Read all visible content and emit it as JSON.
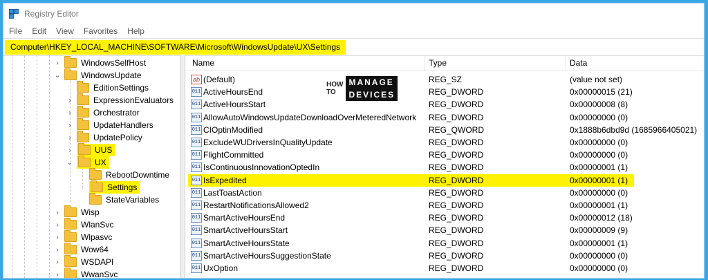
{
  "window": {
    "title": "Registry Editor"
  },
  "menu": [
    "File",
    "Edit",
    "View",
    "Favorites",
    "Help"
  ],
  "address": "Computer\\HKEY_LOCAL_MACHINE\\SOFTWARE\\Microsoft\\WindowsUpdate\\UX\\Settings",
  "tree": [
    {
      "label": "WindowsSelfHost",
      "expander": "›"
    },
    {
      "label": "WindowsUpdate",
      "expander": "⌄"
    },
    {
      "label": "EditionSettings",
      "expander": ""
    },
    {
      "label": "ExpressionEvaluators",
      "expander": "›"
    },
    {
      "label": "Orchestrator",
      "expander": "›"
    },
    {
      "label": "UpdateHandlers",
      "expander": "›"
    },
    {
      "label": "UpdatePolicy",
      "expander": "›"
    },
    {
      "label": "UUS",
      "expander": "›"
    },
    {
      "label": "UX",
      "expander": "⌄"
    },
    {
      "label": "RebootDowntime",
      "expander": ""
    },
    {
      "label": "Settings",
      "expander": ""
    },
    {
      "label": "StateVariables",
      "expander": ""
    },
    {
      "label": "Wisp",
      "expander": "›"
    },
    {
      "label": "WlanSvc",
      "expander": "›"
    },
    {
      "label": "Wlpasvc",
      "expander": "›"
    },
    {
      "label": "Wow64",
      "expander": "›"
    },
    {
      "label": "WSDAPI",
      "expander": "›"
    },
    {
      "label": "WwanSvc",
      "expander": "›"
    }
  ],
  "columns": {
    "name": "Name",
    "type": "Type",
    "data": "Data"
  },
  "values": [
    {
      "name": "(Default)",
      "type": "REG_SZ",
      "data": "(value not set)",
      "icon": "ab"
    },
    {
      "name": "ActiveHoursEnd",
      "type": "REG_DWORD",
      "data": "0x00000015 (21)",
      "icon": "011"
    },
    {
      "name": "ActiveHoursStart",
      "type": "REG_DWORD",
      "data": "0x00000008 (8)",
      "icon": "011"
    },
    {
      "name": "AllowAutoWindowsUpdateDownloadOverMeteredNetwork",
      "type": "REG_DWORD",
      "data": "0x00000000 (0)",
      "icon": "011"
    },
    {
      "name": "CIOptinModified",
      "type": "REG_QWORD",
      "data": "0x1888b6dbd9d (1685966405021)",
      "icon": "011"
    },
    {
      "name": "ExcludeWUDriversInQualityUpdate",
      "type": "REG_DWORD",
      "data": "0x00000000 (0)",
      "icon": "011"
    },
    {
      "name": "FlightCommitted",
      "type": "REG_DWORD",
      "data": "0x00000000 (0)",
      "icon": "011"
    },
    {
      "name": "IsContinuousInnovationOptedIn",
      "type": "REG_DWORD",
      "data": "0x00000001 (1)",
      "icon": "011"
    },
    {
      "name": "IsExpedited",
      "type": "REG_DWORD",
      "data": "0x00000001 (1)",
      "icon": "011"
    },
    {
      "name": "LastToastAction",
      "type": "REG_DWORD",
      "data": "0x00000000 (0)",
      "icon": "011"
    },
    {
      "name": "RestartNotificationsAllowed2",
      "type": "REG_DWORD",
      "data": "0x00000001 (1)",
      "icon": "011"
    },
    {
      "name": "SmartActiveHoursEnd",
      "type": "REG_DWORD",
      "data": "0x00000012 (18)",
      "icon": "011"
    },
    {
      "name": "SmartActiveHoursStart",
      "type": "REG_DWORD",
      "data": "0x00000009 (9)",
      "icon": "011"
    },
    {
      "name": "SmartActiveHoursState",
      "type": "REG_DWORD",
      "data": "0x00000001 (1)",
      "icon": "011"
    },
    {
      "name": "SmartActiveHoursSuggestionState",
      "type": "REG_DWORD",
      "data": "0x00000000 (0)",
      "icon": "011"
    },
    {
      "name": "UxOption",
      "type": "REG_DWORD",
      "data": "0x00000000 (0)",
      "icon": "011"
    }
  ],
  "watermark": {
    "line1": "HOW",
    "line2": "TO",
    "box1": "MANAGE",
    "box2": "DEVICES"
  },
  "colors": {
    "highlight": "#fff200",
    "background": "#39a7e6"
  }
}
